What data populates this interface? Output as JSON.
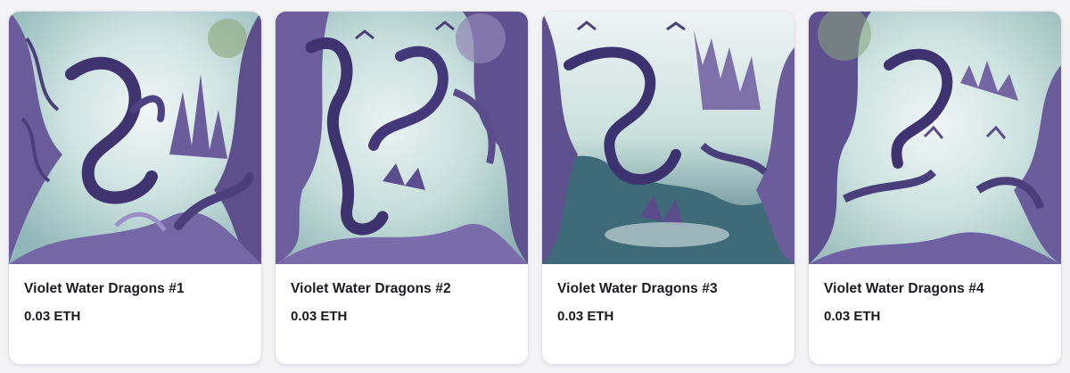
{
  "gallery": {
    "cards": [
      {
        "title": "Violet Water Dragons #1",
        "price": "0.03 ETH"
      },
      {
        "title": "Violet Water Dragons #2",
        "price": "0.03 ETH"
      },
      {
        "title": "Violet Water Dragons #3",
        "price": "0.03 ETH"
      },
      {
        "title": "Violet Water Dragons #4",
        "price": "0.03 ETH"
      }
    ]
  },
  "colors": {
    "card_background": "#ffffff",
    "page_background": "#f3f3f5",
    "text": "#1a1a1f",
    "violet_dark": "#4a3f7a",
    "violet_mid": "#7b6aa8",
    "violet_light": "#b3a6d2",
    "water_light": "#d8ecea",
    "water_teal": "#6f9ea3"
  },
  "icons": [
    "dragon-artwork-image"
  ]
}
